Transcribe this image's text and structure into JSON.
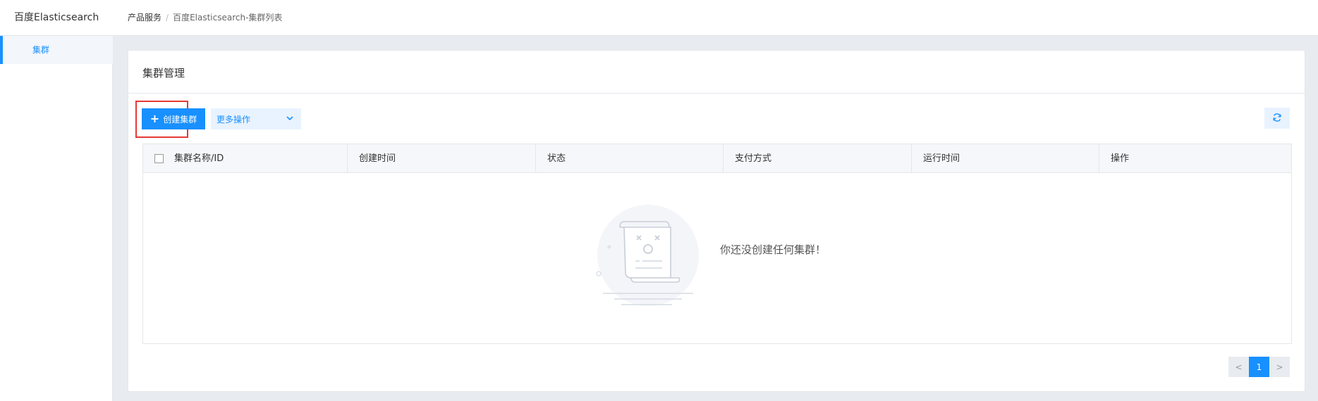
{
  "app": {
    "title": "百度Elasticsearch"
  },
  "breadcrumb": {
    "root": "产品服务",
    "separator": "/",
    "current": "百度Elasticsearch-集群列表"
  },
  "sidebar": {
    "items": [
      {
        "label": "集群"
      }
    ]
  },
  "card": {
    "title": "集群管理"
  },
  "toolbar": {
    "create_label": "创建集群",
    "more_label": "更多操作",
    "refresh_icon": "refresh-icon"
  },
  "table": {
    "columns": [
      "集群名称/ID",
      "创建时间",
      "状态",
      "支付方式",
      "运行时间",
      "操作"
    ],
    "rows": []
  },
  "empty": {
    "message": "你还没创建任何集群！"
  },
  "pagination": {
    "prev": "<",
    "current": "1",
    "next": ">"
  },
  "colors": {
    "accent": "#1890ff",
    "highlight": "#e53935",
    "background": "#e8ebef"
  }
}
